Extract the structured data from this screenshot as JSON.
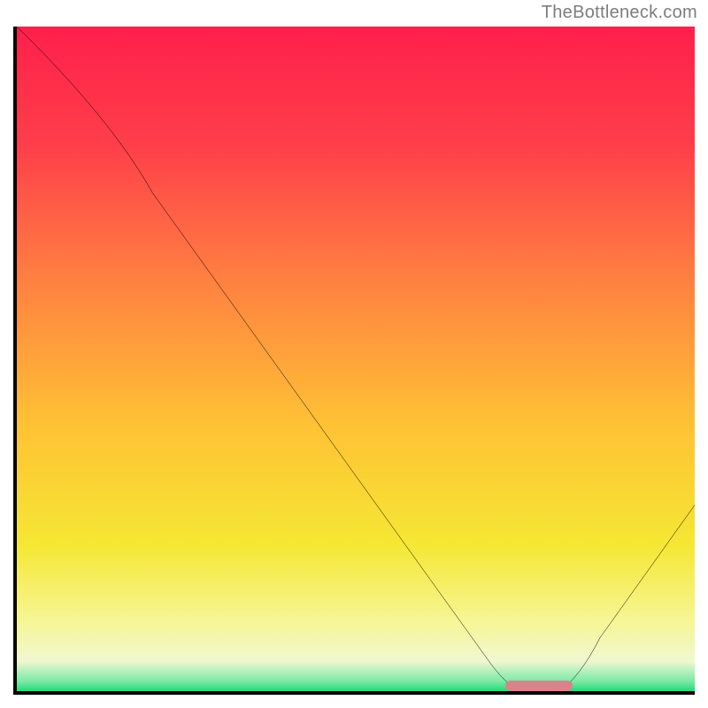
{
  "watermark": "TheBottleneck.com",
  "chart_data": {
    "type": "line",
    "title": "",
    "xlabel": "",
    "ylabel": "",
    "xlim": [
      0,
      100
    ],
    "ylim": [
      0,
      100
    ],
    "grid": false,
    "legend": null,
    "series": [
      {
        "name": "bottleneck-curve",
        "x": [
          0,
          20,
          75,
          80,
          100
        ],
        "y": [
          100,
          75,
          0,
          0,
          28
        ],
        "color": "#000000"
      }
    ],
    "optimal_zone": {
      "x_start": 72,
      "x_end": 82,
      "color": "#d9848a"
    },
    "background_gradient_stops": [
      {
        "offset": 0.0,
        "color": "#ff1f4b"
      },
      {
        "offset": 0.18,
        "color": "#ff3f4a"
      },
      {
        "offset": 0.4,
        "color": "#ff8640"
      },
      {
        "offset": 0.6,
        "color": "#ffc235"
      },
      {
        "offset": 0.78,
        "color": "#f5e733"
      },
      {
        "offset": 0.9,
        "color": "#f6f69a"
      },
      {
        "offset": 0.955,
        "color": "#f0f7d0"
      },
      {
        "offset": 0.985,
        "color": "#7be9a7"
      },
      {
        "offset": 1.0,
        "color": "#22d977"
      }
    ]
  }
}
